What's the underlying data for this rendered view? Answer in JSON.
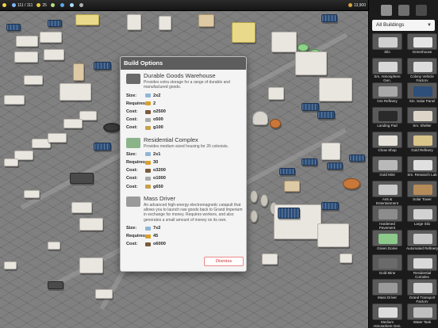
{
  "topbar": {
    "resources": [
      {
        "icon": "sun-icon",
        "color": "#f2d24a",
        "value": ""
      },
      {
        "icon": "colonist-icon",
        "color": "#7fb6ff",
        "value": "111 / 111"
      },
      {
        "icon": "energy-icon",
        "color": "#e8c740",
        "value": "25"
      },
      {
        "icon": "food-icon",
        "color": "#b8e07a",
        "value": ""
      },
      {
        "icon": "water-icon",
        "color": "#5aa8e8",
        "value": ""
      },
      {
        "icon": "oxygen-icon",
        "color": "#a8e0ff",
        "value": ""
      },
      {
        "icon": "metal-icon",
        "color": "#b0b0b0",
        "value": ""
      },
      {
        "icon": "money-icon",
        "color": "#d9a441",
        "value": "13,900"
      }
    ]
  },
  "dialog": {
    "title": "Build Options",
    "dismiss_label": "Dismiss",
    "options": [
      {
        "name": "Durable Goods Warehouse",
        "description": "Provides extra storage for a range of durable and manufactured goods.",
        "thumb_color": "#6a6a6a",
        "stats": [
          {
            "label": "Size:",
            "icon": "grid-icon",
            "icon_color": "#8fb6d8",
            "value": "2x2"
          },
          {
            "label": "Requires:",
            "icon": "bolt-icon",
            "icon_color": "#d8a02a",
            "value": "2"
          },
          {
            "label": "Cost:",
            "icon": "metal-icon",
            "icon_color": "#7a5a3a",
            "value": "o2500"
          },
          {
            "label": "Cost:",
            "icon": "brick-icon",
            "icon_color": "#a9a9a9",
            "value": "o500"
          },
          {
            "label": "Cost:",
            "icon": "money-icon",
            "icon_color": "#c7a04a",
            "value": "g100"
          }
        ]
      },
      {
        "name": "Residential Complex",
        "description": "Provides medium sized housing for 26 colonists.",
        "thumb_color": "#8ab38a",
        "stats": [
          {
            "label": "Size:",
            "icon": "grid-icon",
            "icon_color": "#8fb6d8",
            "value": "2x1"
          },
          {
            "label": "Requires:",
            "icon": "bolt-icon",
            "icon_color": "#d8a02a",
            "value": "30"
          },
          {
            "label": "Cost:",
            "icon": "metal-icon",
            "icon_color": "#7a5a3a",
            "value": "o3200"
          },
          {
            "label": "Cost:",
            "icon": "brick-icon",
            "icon_color": "#a9a9a9",
            "value": "o1000"
          },
          {
            "label": "Cost:",
            "icon": "money-icon",
            "icon_color": "#c7a04a",
            "value": "g650"
          }
        ]
      },
      {
        "name": "Mass Driver",
        "description": "An advanced high-energy electromagnetic catapult that allows you to launch raw goods back to Grand Imperium in exchange for money. Requires workers, and also generates a small amount of money on its own.",
        "thumb_color": "#9a9a9a",
        "stats": [
          {
            "label": "Size:",
            "icon": "grid-icon",
            "icon_color": "#8fb6d8",
            "value": "7x2"
          },
          {
            "label": "Requires:",
            "icon": "bolt-icon",
            "icon_color": "#d8a02a",
            "value": "45"
          },
          {
            "label": "Cost:",
            "icon": "metal-icon",
            "icon_color": "#7a5a3a",
            "value": "o6000"
          }
        ]
      }
    ]
  },
  "panel": {
    "tabs": [
      {
        "icon": "rover-icon",
        "color": "#8f8f8f"
      },
      {
        "icon": "science-icon",
        "color": "#6f6f6f"
      },
      {
        "icon": "crate-icon",
        "color": "#4a4a4a"
      }
    ],
    "filter_label": "All Buildings",
    "tiles": [
      {
        "label": "Silo",
        "color": "#cfcfcf"
      },
      {
        "label": "Greenhouse",
        "color": "#e5e5e5"
      },
      {
        "label": "Sm. Atmosphere Gen.",
        "color": "#d8d8d8"
      },
      {
        "label": "Colony Vehicle Factory",
        "color": "#dcdcdc"
      },
      {
        "label": "Ore Refinery",
        "color": "#a8a8a8"
      },
      {
        "label": "Sm. Solar Panel",
        "color": "#2d4f7a"
      },
      {
        "label": "Landing Pad",
        "color": "#2a2a2a"
      },
      {
        "label": "Sm. Shelter",
        "color": "#ddd6c8"
      },
      {
        "label": "Chow Shop",
        "color": "#e6e2da"
      },
      {
        "label": "Gold Refinery",
        "color": "#d9c48a"
      },
      {
        "label": "Gold Mint",
        "color": "#b9b9b9"
      },
      {
        "label": "Sm. Research Lab",
        "color": "#e0e0e0"
      },
      {
        "label": "Arts & Entertainment Center",
        "color": "#c9c9c9"
      },
      {
        "label": "Solar Tower",
        "color": "#b58b5a"
      },
      {
        "label": "Hardened Pavement",
        "color": "#8c8c8c"
      },
      {
        "label": "Large Silo",
        "color": "#d2d2d2"
      },
      {
        "label": "Green Dome",
        "color": "#8cc98a"
      },
      {
        "label": "Automated Refinery",
        "color": "#c7c7c7"
      },
      {
        "label": "Gold Mine",
        "color": "#6a6a6a"
      },
      {
        "label": "Residential Complex",
        "color": "#d9d9d9"
      },
      {
        "label": "Mass Driver",
        "color": "#9a9a9a"
      },
      {
        "label": "Grand Transport Factory",
        "color": "#cfcfcf"
      },
      {
        "label": "Medium Atmosphere Gen.",
        "color": "#dcdcdc"
      },
      {
        "label": "Water Tank",
        "color": "#bfbfbf"
      }
    ]
  }
}
